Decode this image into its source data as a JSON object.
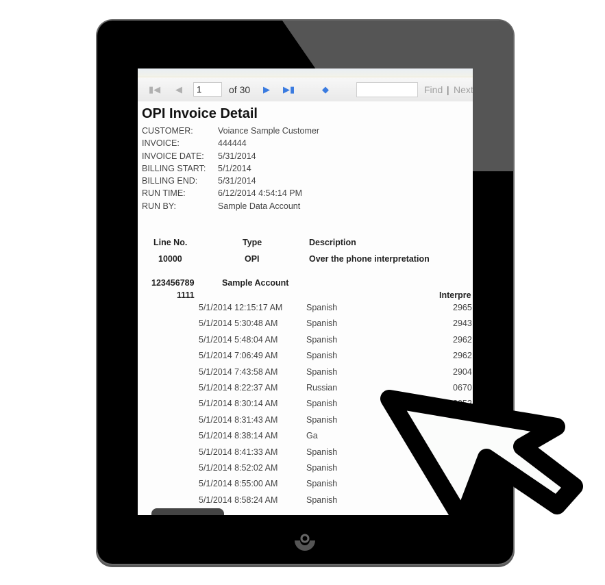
{
  "toolbar": {
    "first_icon": "first-page-icon",
    "prev_icon": "previous-page-icon",
    "page_value": "1",
    "of_label": "of 30",
    "next_icon": "next-page-icon",
    "last_icon": "last-page-icon",
    "back_icon": "back-to-parent-icon",
    "find_value": "",
    "find_label": "Find",
    "separator": "|",
    "next_label": "Next",
    "accent": "#3a7be0"
  },
  "report": {
    "title": "OPI Invoice Detail",
    "meta": [
      {
        "label": "CUSTOMER:",
        "value": "Voiance Sample Customer"
      },
      {
        "label": "INVOICE:",
        "value": "444444"
      },
      {
        "label": "INVOICE DATE:",
        "value": "5/31/2014"
      },
      {
        "label": "BILLING START:",
        "value": "5/1/2014"
      },
      {
        "label": "BILLING END:",
        "value": "5/31/2014"
      },
      {
        "label": "RUN TIME:",
        "value": "6/12/2014 4:54:14 PM"
      },
      {
        "label": "RUN BY:",
        "value": "Sample Data Account"
      }
    ],
    "line_headers": {
      "line_no": "Line No.",
      "type": "Type",
      "description": "Description"
    },
    "line": {
      "line_no": "10000",
      "type": "OPI",
      "description": "Over the phone interpretation"
    },
    "account": {
      "number": "123456789",
      "name": "Sample Account",
      "sub": "1111",
      "column_header": "Interpre"
    },
    "calls": [
      {
        "time": "5/1/2014 12:15:17 AM",
        "language": "Spanish",
        "interpreter": "2965"
      },
      {
        "time": "5/1/2014 5:30:48 AM",
        "language": "Spanish",
        "interpreter": "2943"
      },
      {
        "time": "5/1/2014 5:48:04 AM",
        "language": "Spanish",
        "interpreter": "2962"
      },
      {
        "time": "5/1/2014 7:06:49 AM",
        "language": "Spanish",
        "interpreter": "2962"
      },
      {
        "time": "5/1/2014 7:43:58 AM",
        "language": "Spanish",
        "interpreter": "2904"
      },
      {
        "time": "5/1/2014 8:22:37 AM",
        "language": "Russian",
        "interpreter": "0670"
      },
      {
        "time": "5/1/2014 8:30:14 AM",
        "language": "Spanish",
        "interpreter": "2052"
      },
      {
        "time": "5/1/2014 8:31:43 AM",
        "language": "Spanish",
        "interpreter": ""
      },
      {
        "time": "5/1/2014 8:38:14 AM",
        "language": "Ga",
        "interpreter": ""
      },
      {
        "time": "5/1/2014 8:41:33 AM",
        "language": "Spanish",
        "interpreter": ""
      },
      {
        "time": "5/1/2014 8:52:02 AM",
        "language": "Spanish",
        "interpreter": ""
      },
      {
        "time": "5/1/2014 8:55:00 AM",
        "language": "Spanish",
        "interpreter": ""
      },
      {
        "time": "5/1/2014 8:58:24 AM",
        "language": "Spanish",
        "interpreter": ""
      }
    ]
  },
  "overlay": {
    "cursor_icon": "mouse-pointer-icon",
    "home_icon": "home-button-icon"
  }
}
